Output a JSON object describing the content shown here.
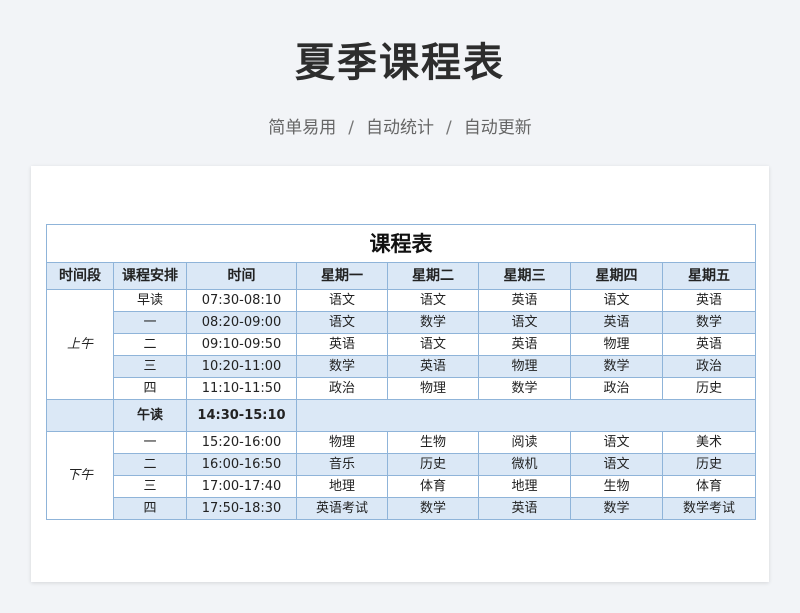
{
  "page": {
    "title": "夏季课程表",
    "subtitle_items": [
      "简单易用",
      "自动统计",
      "自动更新"
    ],
    "separator": "/"
  },
  "table": {
    "title": "课程表",
    "headers": [
      "时间段",
      "课程安排",
      "时间",
      "星期一",
      "星期二",
      "星期三",
      "星期四",
      "星期五"
    ],
    "morning": {
      "label": "上午",
      "rows": [
        {
          "slot": "早读",
          "time": "07:30-08:10",
          "courses": [
            "语文",
            "语文",
            "英语",
            "语文",
            "英语"
          ]
        },
        {
          "slot": "一",
          "time": "08:20-09:00",
          "courses": [
            "语文",
            "数学",
            "语文",
            "英语",
            "数学"
          ]
        },
        {
          "slot": "二",
          "time": "09:10-09:50",
          "courses": [
            "英语",
            "语文",
            "英语",
            "物理",
            "英语"
          ]
        },
        {
          "slot": "三",
          "time": "10:20-11:00",
          "courses": [
            "数学",
            "英语",
            "物理",
            "数学",
            "政治"
          ]
        },
        {
          "slot": "四",
          "time": "11:10-11:50",
          "courses": [
            "政治",
            "物理",
            "数学",
            "政治",
            "历史"
          ]
        }
      ]
    },
    "lunch": {
      "slot": "午读",
      "time": "14:30-15:10"
    },
    "afternoon": {
      "label": "下午",
      "rows": [
        {
          "slot": "一",
          "time": "15:20-16:00",
          "courses": [
            "物理",
            "生物",
            "阅读",
            "语文",
            "美术"
          ]
        },
        {
          "slot": "二",
          "time": "16:00-16:50",
          "courses": [
            "音乐",
            "历史",
            "微机",
            "语文",
            "历史"
          ]
        },
        {
          "slot": "三",
          "time": "17:00-17:40",
          "courses": [
            "地理",
            "体育",
            "地理",
            "生物",
            "体育"
          ]
        },
        {
          "slot": "四",
          "time": "17:50-18:30",
          "courses": [
            "英语考试",
            "数学",
            "英语",
            "数学",
            "数学考试"
          ]
        }
      ]
    }
  },
  "colors": {
    "header_fill": "#dbe8f6",
    "border": "#8fb4d9",
    "background": "#f2f4f7"
  }
}
